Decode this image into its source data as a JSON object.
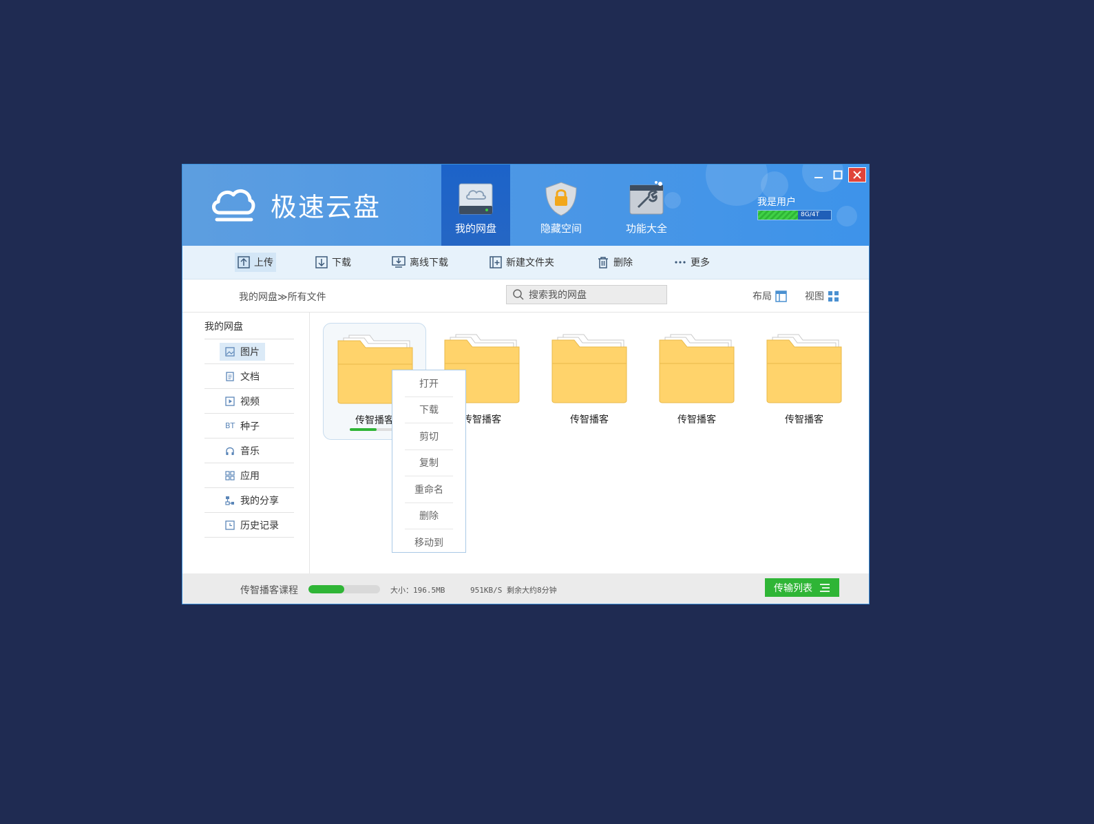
{
  "app": {
    "name": "极速云盘"
  },
  "nav": [
    {
      "label": "我的网盘",
      "icon": "cloud-drive-icon",
      "active": true
    },
    {
      "label": "隐藏空间",
      "icon": "lock-shield-icon",
      "active": false
    },
    {
      "label": "功能大全",
      "icon": "tools-icon",
      "active": false
    }
  ],
  "user": {
    "name": "我是用户",
    "quota_text": "8G/4T",
    "quota_fraction": 0.55
  },
  "toolbar": {
    "upload": "上传",
    "download": "下载",
    "offline": "离线下载",
    "new_folder": "新建文件夹",
    "delete": "删除",
    "more": "更多"
  },
  "path": {
    "root": "我的网盘",
    "separator": "≫",
    "current": "所有文件"
  },
  "search": {
    "placeholder": "搜索我的网盘"
  },
  "view": {
    "layout": "布局",
    "view": "视图"
  },
  "sidebar": {
    "title": "我的网盘",
    "items": [
      {
        "label": "图片",
        "icon": "image-icon"
      },
      {
        "label": "文档",
        "icon": "document-icon"
      },
      {
        "label": "视频",
        "icon": "video-icon"
      },
      {
        "label": "种子",
        "icon": "bt-icon",
        "icon_text": "BT"
      },
      {
        "label": "音乐",
        "icon": "headphones-icon"
      },
      {
        "label": "应用",
        "icon": "apps-icon"
      },
      {
        "label": "我的分享",
        "icon": "share-icon"
      },
      {
        "label": "历史记录",
        "icon": "history-icon"
      }
    ]
  },
  "folders": [
    {
      "name": "传智播客",
      "progress": 0.55
    },
    {
      "name": "传智播客"
    },
    {
      "name": "传智播客"
    },
    {
      "name": "传智播客"
    },
    {
      "name": "传智播客"
    }
  ],
  "context_menu": [
    "打开",
    "下载",
    "剪切",
    "复制",
    "重命名",
    "删除",
    "移动到"
  ],
  "status": {
    "name": "传智播客课程",
    "progress": 0.5,
    "size": "大小：196.5MB",
    "speed": "951KB/S 剩余大约8分钟",
    "transfer_label": "传输列表"
  },
  "colors": {
    "accent": "#2fb536",
    "header": "#4f98e4",
    "active_tab": "#1c63c9",
    "folder": "#ffd36b",
    "background": "#1f2b52"
  }
}
